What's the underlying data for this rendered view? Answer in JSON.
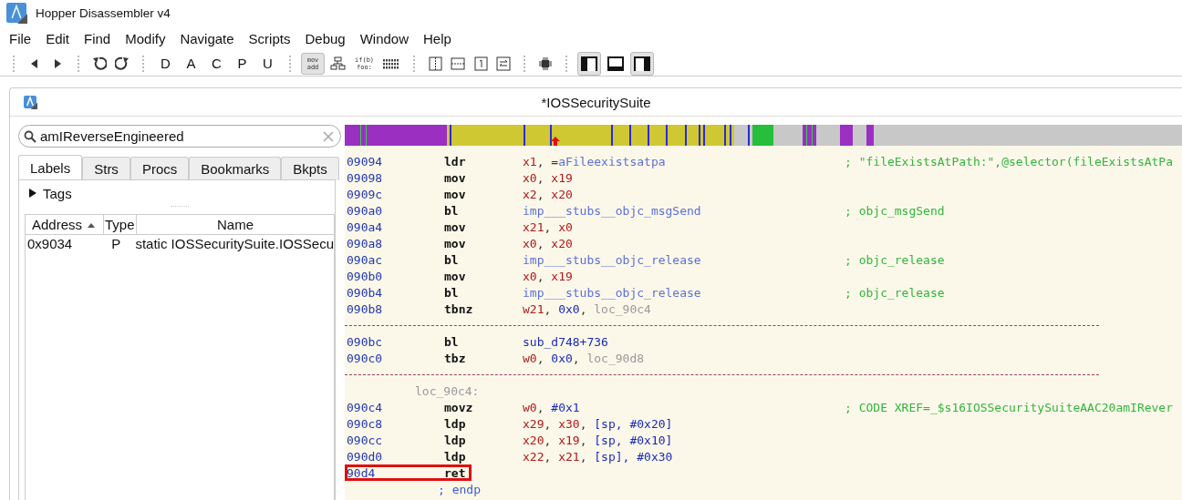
{
  "window": {
    "title": "Hopper Disassembler v4"
  },
  "menu": [
    "File",
    "Edit",
    "Find",
    "Modify",
    "Navigate",
    "Scripts",
    "Debug",
    "Window",
    "Help"
  ],
  "toolbar": {
    "letters": [
      "D",
      "A",
      "C",
      "P",
      "U"
    ],
    "view_modes": [
      {
        "label": [
          "mov",
          "add"
        ],
        "selected": true
      },
      {
        "selected": false
      },
      {
        "label": [
          "if(b)",
          "foo:"
        ],
        "selected": false
      },
      {
        "selected": false
      }
    ],
    "layout_toggles": [
      {
        "selected": true
      },
      {
        "selected": false
      },
      {
        "selected": true
      }
    ]
  },
  "document": {
    "title": "*IOSSecuritySuite"
  },
  "sidebar": {
    "search": {
      "value": "amIReverseEngineered"
    },
    "tabs": [
      {
        "label": "Labels",
        "selected": true
      },
      {
        "label": "Strs",
        "selected": false
      },
      {
        "label": "Procs",
        "selected": false
      },
      {
        "label": "Bookmarks",
        "selected": false
      },
      {
        "label": "Bkpts",
        "selected": false
      }
    ],
    "tags": {
      "label": "Tags",
      "expanded": false
    },
    "table": {
      "columns": [
        {
          "label": "Address",
          "sorted": true
        },
        {
          "label": "Type"
        },
        {
          "label": "Name"
        }
      ],
      "rows": [
        {
          "cells": [
            "0x9034",
            "P",
            "static IOSSecuritySuite.IOSSecu"
          ]
        }
      ]
    }
  },
  "code": {
    "lines": [
      {
        "kind": "instruction",
        "address": "09094",
        "mnemonic": "ldr",
        "operands": [
          {
            "kind": "reg",
            "text": "x1"
          },
          {
            "kind": "punct",
            "text": ", ="
          },
          {
            "kind": "sym",
            "text": "aFileexistsatpa"
          }
        ],
        "comment": "; \"fileExistsAtPath:\",@selector(fileExistsAtPa"
      },
      {
        "kind": "instruction",
        "address": "09098",
        "mnemonic": "mov",
        "operands": [
          {
            "kind": "reg",
            "text": "x0"
          },
          {
            "kind": "punct",
            "text": ", "
          },
          {
            "kind": "reg",
            "text": "x19"
          }
        ]
      },
      {
        "kind": "instruction",
        "address": "0909c",
        "mnemonic": "mov",
        "operands": [
          {
            "kind": "reg",
            "text": "x2"
          },
          {
            "kind": "punct",
            "text": ", "
          },
          {
            "kind": "reg",
            "text": "x20"
          }
        ]
      },
      {
        "kind": "instruction",
        "address": "090a0",
        "mnemonic": "bl",
        "operands": [
          {
            "kind": "sym",
            "text": "imp___stubs__objc_msgSend"
          }
        ],
        "comment": "; objc_msgSend"
      },
      {
        "kind": "instruction",
        "address": "090a4",
        "mnemonic": "mov",
        "operands": [
          {
            "kind": "reg",
            "text": "x21"
          },
          {
            "kind": "punct",
            "text": ", "
          },
          {
            "kind": "reg",
            "text": "x0"
          }
        ]
      },
      {
        "kind": "instruction",
        "address": "090a8",
        "mnemonic": "mov",
        "operands": [
          {
            "kind": "reg",
            "text": "x0"
          },
          {
            "kind": "punct",
            "text": ", "
          },
          {
            "kind": "reg",
            "text": "x20"
          }
        ]
      },
      {
        "kind": "instruction",
        "address": "090ac",
        "mnemonic": "bl",
        "operands": [
          {
            "kind": "sym",
            "text": "imp___stubs__objc_release"
          }
        ],
        "comment": "; objc_release"
      },
      {
        "kind": "instruction",
        "address": "090b0",
        "mnemonic": "mov",
        "operands": [
          {
            "kind": "reg",
            "text": "x0"
          },
          {
            "kind": "punct",
            "text": ", "
          },
          {
            "kind": "reg",
            "text": "x19"
          }
        ]
      },
      {
        "kind": "instruction",
        "address": "090b4",
        "mnemonic": "bl",
        "operands": [
          {
            "kind": "sym",
            "text": "imp___stubs__objc_release"
          }
        ],
        "comment": "; objc_release"
      },
      {
        "kind": "instruction",
        "address": "090b8",
        "mnemonic": "tbnz",
        "operands": [
          {
            "kind": "reg",
            "text": "w21"
          },
          {
            "kind": "punct",
            "text": ", "
          },
          {
            "kind": "num",
            "text": "0x0"
          },
          {
            "kind": "punct",
            "text": ", "
          },
          {
            "kind": "loc",
            "text": "loc_90c4"
          }
        ]
      },
      {
        "kind": "separator"
      },
      {
        "kind": "instruction",
        "address": "090bc",
        "mnemonic": "bl",
        "operands": [
          {
            "kind": "num",
            "text": "sub_d748+736"
          }
        ]
      },
      {
        "kind": "instruction",
        "address": "090c0",
        "mnemonic": "tbz",
        "operands": [
          {
            "kind": "reg",
            "text": "w0"
          },
          {
            "kind": "punct",
            "text": ", "
          },
          {
            "kind": "num",
            "text": "0x0"
          },
          {
            "kind": "punct",
            "text": ", "
          },
          {
            "kind": "loc",
            "text": "loc_90d8"
          }
        ]
      },
      {
        "kind": "separator"
      },
      {
        "kind": "label",
        "text": "loc_90c4:"
      },
      {
        "kind": "instruction",
        "address": "090c4",
        "mnemonic": "movz",
        "operands": [
          {
            "kind": "reg",
            "text": "w0"
          },
          {
            "kind": "punct",
            "text": ", "
          },
          {
            "kind": "num",
            "text": "#0x1"
          }
        ],
        "comment": "; CODE XREF=_$s16IOSSecuritySuiteAAC20amIRever"
      },
      {
        "kind": "instruction",
        "address": "090c8",
        "mnemonic": "ldp",
        "operands": [
          {
            "kind": "reg",
            "text": "x29"
          },
          {
            "kind": "punct",
            "text": ", "
          },
          {
            "kind": "reg",
            "text": "x30"
          },
          {
            "kind": "punct",
            "text": ", "
          },
          {
            "kind": "num",
            "text": "[sp, #0x20]"
          }
        ]
      },
      {
        "kind": "instruction",
        "address": "090cc",
        "mnemonic": "ldp",
        "operands": [
          {
            "kind": "reg",
            "text": "x20"
          },
          {
            "kind": "punct",
            "text": ", "
          },
          {
            "kind": "reg",
            "text": "x19"
          },
          {
            "kind": "punct",
            "text": ", "
          },
          {
            "kind": "num",
            "text": "[sp, #0x10]"
          }
        ]
      },
      {
        "kind": "instruction",
        "address": "090d0",
        "mnemonic": "ldp",
        "operands": [
          {
            "kind": "reg",
            "text": "x22"
          },
          {
            "kind": "punct",
            "text": ", "
          },
          {
            "kind": "reg",
            "text": "x21"
          },
          {
            "kind": "punct",
            "text": ", "
          },
          {
            "kind": "num",
            "text": "[sp], #0x30"
          }
        ]
      },
      {
        "kind": "instruction",
        "address": "90d4",
        "mnemonic": "ret",
        "highlighted": true
      },
      {
        "kind": "endp",
        "text": "; endp"
      }
    ]
  }
}
